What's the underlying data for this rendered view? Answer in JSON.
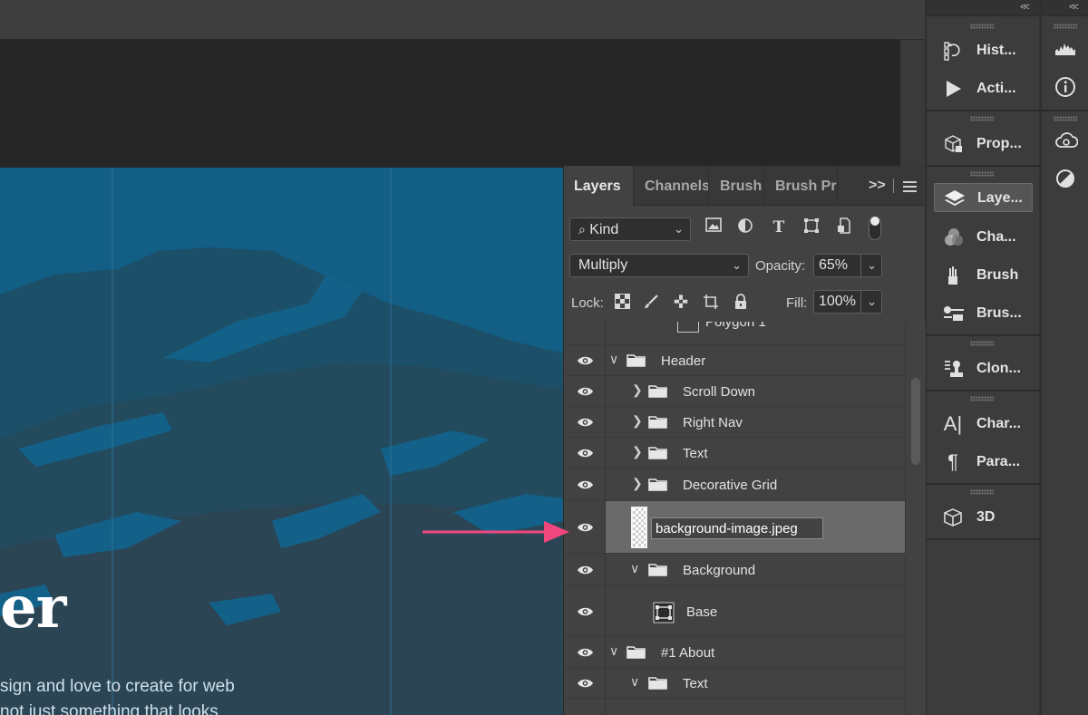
{
  "canvas": {
    "title_fragment": "er",
    "body_lines": [
      "sign and love to create for web",
      "not just something that looks"
    ]
  },
  "layers_panel": {
    "tabs": [
      {
        "label": "Layers",
        "active": true
      },
      {
        "label": "Channels",
        "active": false
      },
      {
        "label": "Brush",
        "active": false
      },
      {
        "label": "Brush Pre",
        "active": false
      }
    ],
    "expand_glyph": ">>",
    "filter_kind": "Kind",
    "blend_mode": "Multiply",
    "opacity_label": "Opacity:",
    "opacity_value": "65%",
    "lock_label": "Lock:",
    "fill_label": "Fill:",
    "fill_value": "100%",
    "layers": [
      {
        "name": "Polygon 1",
        "type": "shape",
        "partially_visible": true
      },
      {
        "name": "Header",
        "type": "group",
        "expanded": true
      },
      {
        "name": "Scroll Down",
        "type": "group",
        "expanded": false
      },
      {
        "name": "Right Nav",
        "type": "group",
        "expanded": false
      },
      {
        "name": "Text",
        "type": "group",
        "expanded": false
      },
      {
        "name": "Decorative Grid",
        "type": "group",
        "expanded": false
      },
      {
        "name": "background-image.jpeg",
        "type": "image",
        "selected": true,
        "renaming": true
      },
      {
        "name": "Background",
        "type": "group",
        "expanded": true
      },
      {
        "name": "Base",
        "type": "shape"
      },
      {
        "name": "#1 About",
        "type": "group",
        "expanded": true
      },
      {
        "name": "Text",
        "type": "group",
        "expanded": true
      }
    ],
    "annotation_color": "#f0487e"
  },
  "dock": {
    "items": [
      {
        "label": "Hist...",
        "icon": "history-icon"
      },
      {
        "label": "Acti...",
        "icon": "actions-play-icon"
      },
      {
        "label": "Prop...",
        "icon": "properties-icon"
      },
      {
        "label": "Laye...",
        "icon": "layers-icon",
        "active": true
      },
      {
        "label": "Cha...",
        "icon": "channels-icon"
      },
      {
        "label": "Brush",
        "icon": "brush-icon"
      },
      {
        "label": "Brus...",
        "icon": "brush-settings-icon"
      },
      {
        "label": "Clon...",
        "icon": "clone-source-icon"
      },
      {
        "label": "Char...",
        "icon": "character-icon"
      },
      {
        "label": "Para...",
        "icon": "paragraph-icon"
      },
      {
        "label": "3D",
        "icon": "3d-cube-icon"
      }
    ],
    "collapse_glyph": "<<",
    "icons2": [
      "histogram-icon",
      "info-icon",
      "creative-cloud-icon",
      "adjustments-icon"
    ]
  }
}
